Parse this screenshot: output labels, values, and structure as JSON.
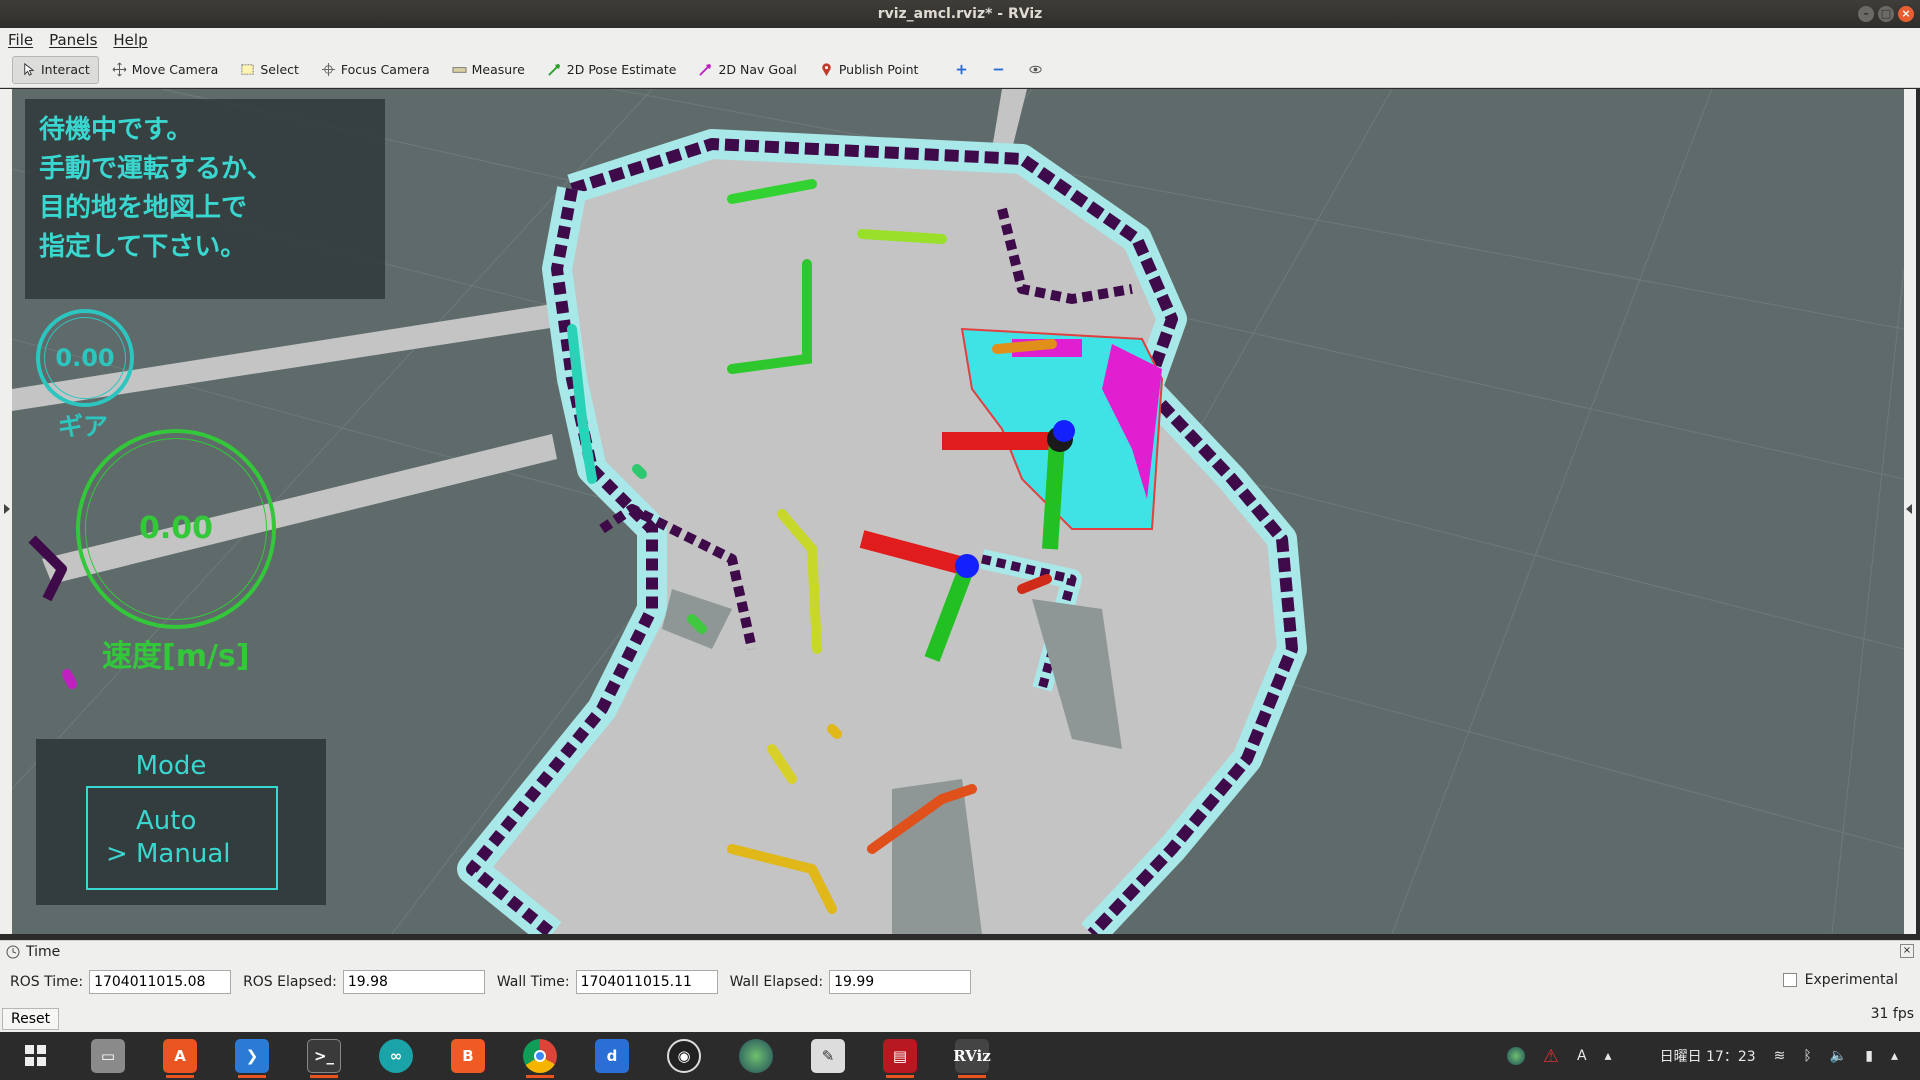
{
  "window": {
    "title": "rviz_amcl.rviz* - RViz"
  },
  "menu": {
    "items": [
      "File",
      "Panels",
      "Help"
    ]
  },
  "toolbar": {
    "tools": [
      {
        "label": "Interact",
        "icon": "cursor-icon",
        "active": true
      },
      {
        "label": "Move Camera",
        "icon": "move-camera-icon"
      },
      {
        "label": "Select",
        "icon": "select-rectangle-icon"
      },
      {
        "label": "Focus Camera",
        "icon": "focus-crosshair-icon"
      },
      {
        "label": "Measure",
        "icon": "ruler-icon"
      },
      {
        "label": "2D Pose Estimate",
        "icon": "green-arrow-icon"
      },
      {
        "label": "2D Nav Goal",
        "icon": "magenta-arrow-icon"
      },
      {
        "label": "Publish Point",
        "icon": "map-pin-icon"
      }
    ]
  },
  "overlay": {
    "status_lines": [
      "待機中です。",
      "手動で運転するか、",
      "目的地を地図上で",
      "指定して下さい。"
    ],
    "gear": {
      "value": "0.00",
      "label": "ギア"
    },
    "speed": {
      "value": "0.00",
      "label": "速度[m/s]"
    },
    "mode": {
      "title": "Mode",
      "options": [
        "Auto",
        "Manual"
      ],
      "selected": "Manual",
      "cursor": ">"
    }
  },
  "time_panel": {
    "title": "Time",
    "ros_time_label": "ROS Time:",
    "ros_time": "1704011015.08",
    "ros_elapsed_label": "ROS Elapsed:",
    "ros_elapsed": "19.98",
    "wall_time_label": "Wall Time:",
    "wall_time": "1704011015.11",
    "wall_elapsed_label": "Wall Elapsed:",
    "wall_elapsed": "19.99",
    "experimental_label": "Experimental",
    "reset_label": "Reset",
    "fps": "31 fps"
  },
  "taskbar": {
    "apps": [
      {
        "name": "activities-icon",
        "color": "#2b2b2b"
      },
      {
        "name": "files-icon",
        "color": "#8a8a8a"
      },
      {
        "name": "software-center-icon",
        "color": "#e95420"
      },
      {
        "name": "vscode-icon",
        "color": "#2a7bd6"
      },
      {
        "name": "terminal-icon",
        "color": "#3a3a3a"
      },
      {
        "name": "arduino-icon",
        "color": "#1aa3a9"
      },
      {
        "name": "brave-icon",
        "color": "#f05a24"
      },
      {
        "name": "chrome-icon",
        "color": "#3a8f3a"
      },
      {
        "name": "dict-icon",
        "color": "#2a6fd6"
      },
      {
        "name": "obs-icon",
        "color": "#222222"
      },
      {
        "name": "globe-app-icon",
        "color": "#2f6b3a"
      },
      {
        "name": "text-editor-icon",
        "color": "#dddddd"
      },
      {
        "name": "red-app-icon",
        "color": "#b8181f"
      },
      {
        "name": "rviz-icon",
        "color": "#444444",
        "label": "RViz"
      }
    ],
    "tray": {
      "input_method": "A",
      "clock": "日曜日 17：23"
    }
  },
  "colors": {
    "viewport_bg": "#5f6b6b",
    "free_space": "#c4c4c4",
    "wall": "#3f0a4a",
    "inflation": "#a8e8e8",
    "overlay_text": "#39d7d0",
    "speed_green": "#33c83a"
  }
}
